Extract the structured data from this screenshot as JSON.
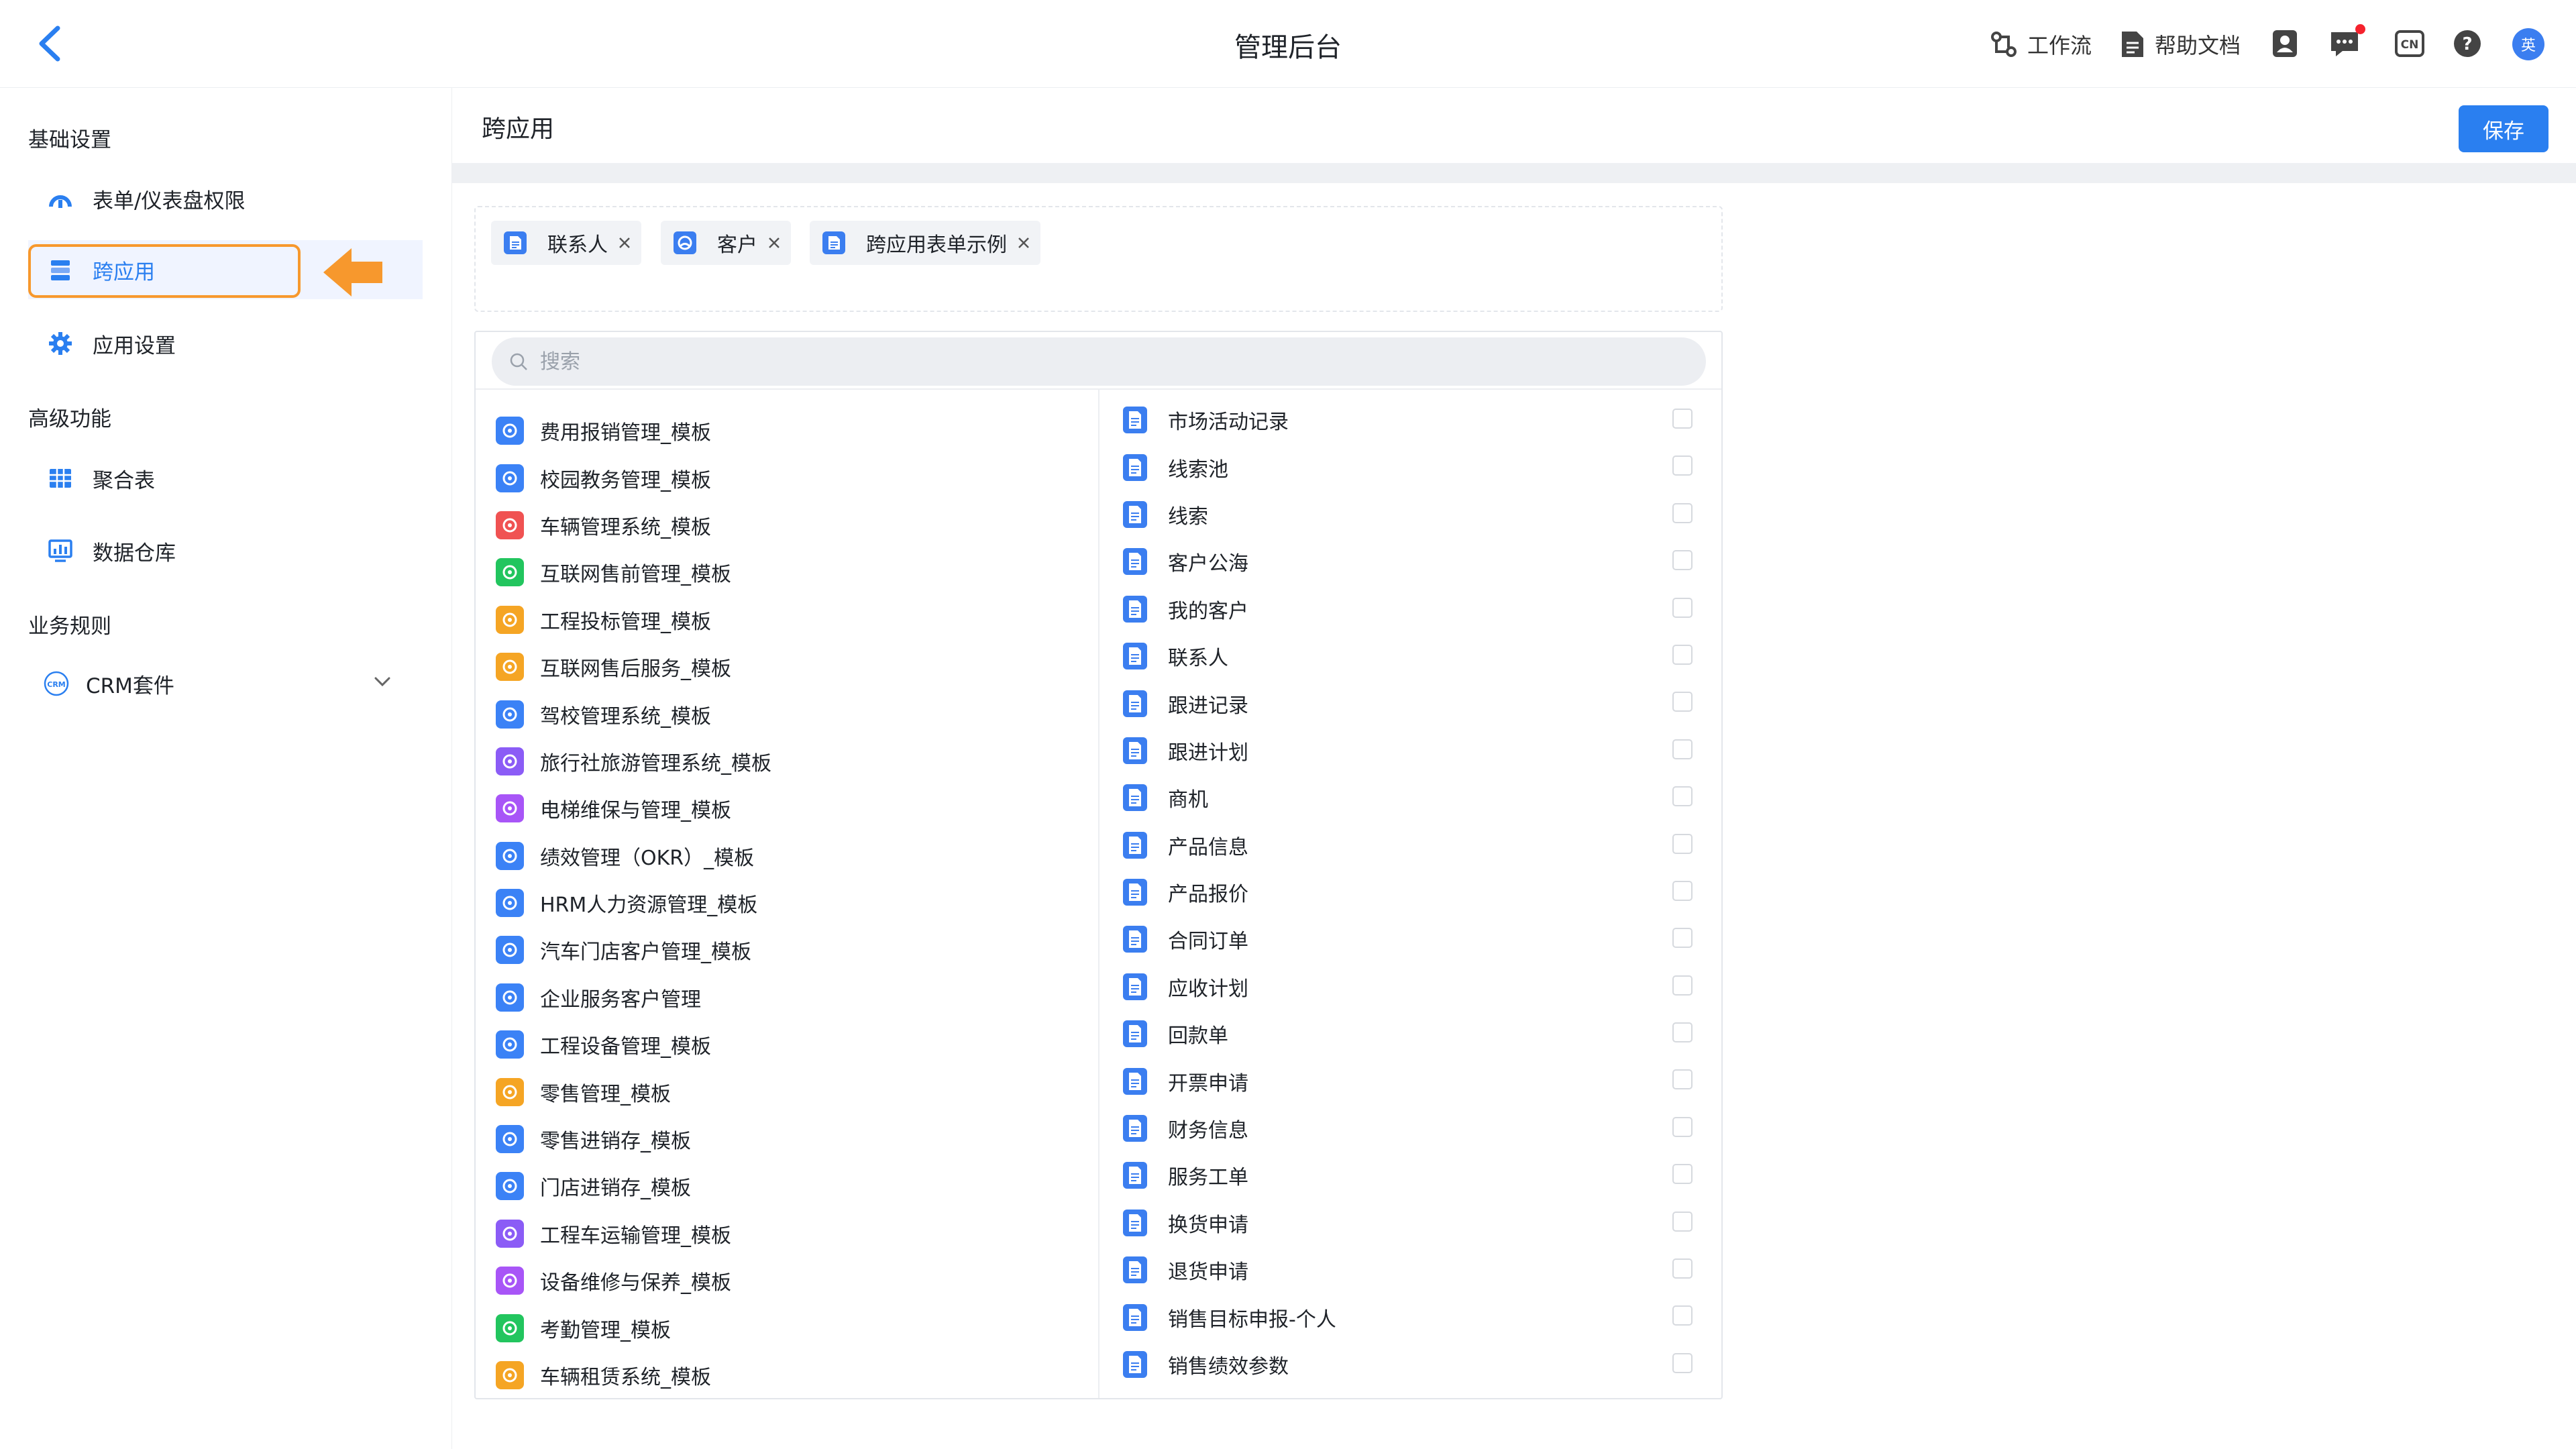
{
  "header": {
    "title": "管理后台",
    "workflow_label": "工作流",
    "help_label": "帮助文档",
    "avatar_text": "英",
    "icons": [
      "back-icon",
      "workflow-icon",
      "help-doc-icon",
      "contacts-icon",
      "message-icon",
      "language-cn-icon",
      "question-icon"
    ]
  },
  "sidebar": {
    "sections": [
      {
        "title": "基础设置",
        "items": [
          {
            "label": "表单/仪表盘权限",
            "icon": "dashboard-permission-icon"
          },
          {
            "label": "跨应用",
            "icon": "cross-app-icon",
            "active": true
          },
          {
            "label": "应用设置",
            "icon": "gear-icon"
          }
        ]
      },
      {
        "title": "高级功能",
        "items": [
          {
            "label": "聚合表",
            "icon": "table-grid-icon"
          },
          {
            "label": "数据仓库",
            "icon": "data-warehouse-icon"
          }
        ]
      },
      {
        "title": "业务规则",
        "items": [
          {
            "label": "CRM套件",
            "icon": "crm-icon",
            "expandable": true
          }
        ]
      }
    ]
  },
  "main": {
    "title": "跨应用",
    "save_label": "保存",
    "selected_tags": [
      {
        "label": "联系人",
        "icon": "form-doc-icon"
      },
      {
        "label": "客户",
        "icon": "customer-icon"
      },
      {
        "label": "跨应用表单示例",
        "icon": "form-doc-icon"
      }
    ],
    "search": {
      "placeholder": "搜索",
      "value": ""
    },
    "apps": [
      {
        "label": "费用报销管理_模板",
        "color": "#3b82f6"
      },
      {
        "label": "校园教务管理_模板",
        "color": "#3b82f6"
      },
      {
        "label": "车辆管理系统_模板",
        "color": "#f05252"
      },
      {
        "label": "互联网售前管理_模板",
        "color": "#22c55e"
      },
      {
        "label": "工程投标管理_模板",
        "color": "#f5a524"
      },
      {
        "label": "互联网售后服务_模板",
        "color": "#f5a524"
      },
      {
        "label": "驾校管理系统_模板",
        "color": "#3b82f6"
      },
      {
        "label": "旅行社旅游管理系统_模板",
        "color": "#8b5cf6"
      },
      {
        "label": "电梯维保与管理_模板",
        "color": "#a855f7"
      },
      {
        "label": "绩效管理（OKR）_模板",
        "color": "#3b82f6"
      },
      {
        "label": "HRM人力资源管理_模板",
        "color": "#3b82f6"
      },
      {
        "label": "汽车门店客户管理_模板",
        "color": "#3b82f6"
      },
      {
        "label": "企业服务客户管理",
        "color": "#3b82f6"
      },
      {
        "label": "工程设备管理_模板",
        "color": "#3b82f6"
      },
      {
        "label": "零售管理_模板",
        "color": "#f5a524"
      },
      {
        "label": "零售进销存_模板",
        "color": "#3b82f6"
      },
      {
        "label": "门店进销存_模板",
        "color": "#3b82f6"
      },
      {
        "label": "工程车运输管理_模板",
        "color": "#8b5cf6"
      },
      {
        "label": "设备维修与保养_模板",
        "color": "#a855f7"
      },
      {
        "label": "考勤管理_模板",
        "color": "#22c55e"
      },
      {
        "label": "车辆租赁系统_模板",
        "color": "#f5a524"
      }
    ],
    "forms": [
      {
        "label": "市场活动记录",
        "checked": false
      },
      {
        "label": "线索池",
        "checked": false
      },
      {
        "label": "线索",
        "checked": false
      },
      {
        "label": "客户公海",
        "checked": false
      },
      {
        "label": "我的客户",
        "checked": false
      },
      {
        "label": "联系人",
        "checked": false
      },
      {
        "label": "跟进记录",
        "checked": false
      },
      {
        "label": "跟进计划",
        "checked": false
      },
      {
        "label": "商机",
        "checked": false
      },
      {
        "label": "产品信息",
        "checked": false
      },
      {
        "label": "产品报价",
        "checked": false
      },
      {
        "label": "合同订单",
        "checked": false
      },
      {
        "label": "应收计划",
        "checked": false
      },
      {
        "label": "回款单",
        "checked": false
      },
      {
        "label": "开票申请",
        "checked": false
      },
      {
        "label": "财务信息",
        "checked": false
      },
      {
        "label": "服务工单",
        "checked": false
      },
      {
        "label": "换货申请",
        "checked": false
      },
      {
        "label": "退货申请",
        "checked": false
      },
      {
        "label": "销售目标申报-个人",
        "checked": false
      },
      {
        "label": "销售绩效参数",
        "checked": false
      }
    ]
  },
  "colors": {
    "accent": "#2a7ff0",
    "highlight": "#f7982d"
  }
}
